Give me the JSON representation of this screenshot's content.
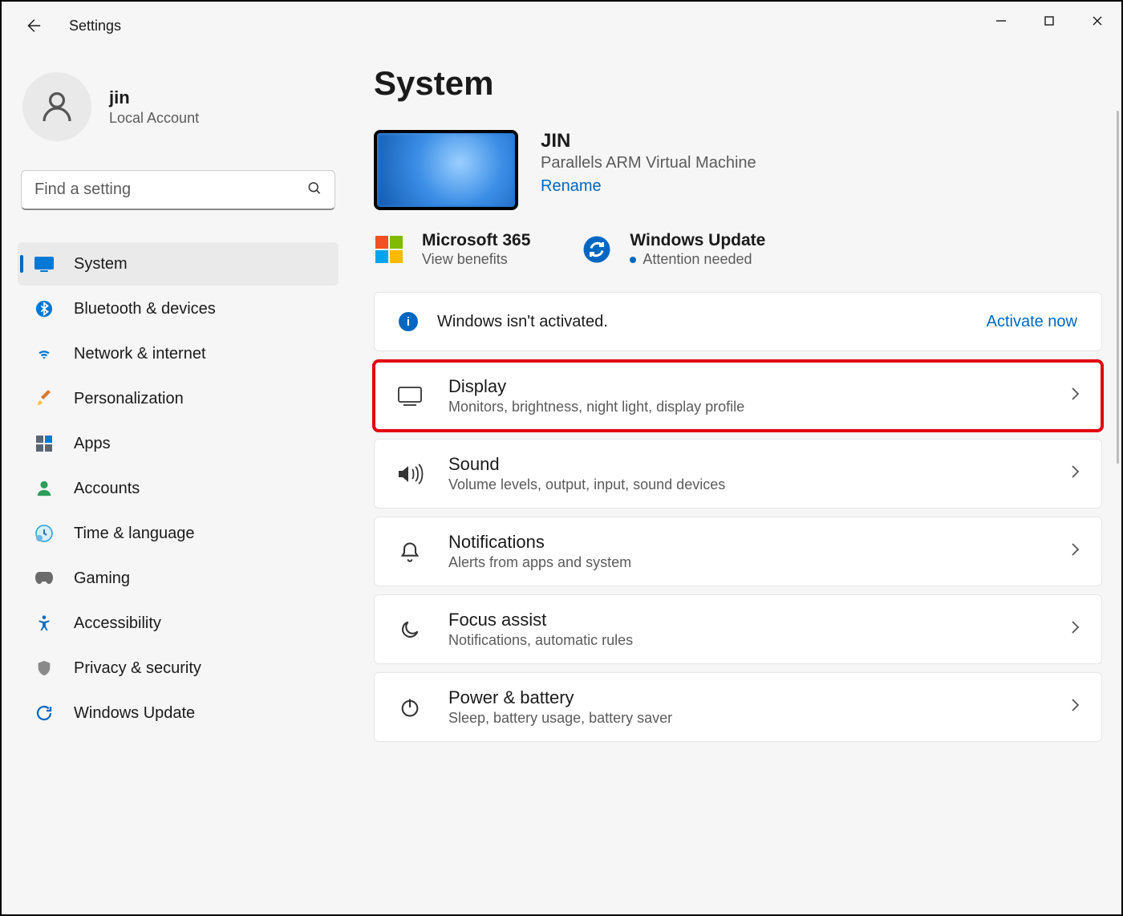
{
  "app_title": "Settings",
  "user": {
    "name": "jin",
    "subtitle": "Local Account"
  },
  "search": {
    "placeholder": "Find a setting"
  },
  "nav": [
    {
      "label": "System",
      "icon": "monitor",
      "selected": true
    },
    {
      "label": "Bluetooth & devices",
      "icon": "bluetooth"
    },
    {
      "label": "Network & internet",
      "icon": "wifi"
    },
    {
      "label": "Personalization",
      "icon": "brush"
    },
    {
      "label": "Apps",
      "icon": "apps"
    },
    {
      "label": "Accounts",
      "icon": "person"
    },
    {
      "label": "Time & language",
      "icon": "clock"
    },
    {
      "label": "Gaming",
      "icon": "gamepad"
    },
    {
      "label": "Accessibility",
      "icon": "accessibility"
    },
    {
      "label": "Privacy & security",
      "icon": "shield"
    },
    {
      "label": "Windows Update",
      "icon": "update"
    }
  ],
  "page": {
    "title": "System",
    "device": {
      "name": "JIN",
      "desc": "Parallels ARM Virtual Machine",
      "rename": "Rename"
    },
    "quick": {
      "m365": {
        "title": "Microsoft 365",
        "sub": "View benefits"
      },
      "wu": {
        "title": "Windows Update",
        "sub": "Attention needed"
      }
    },
    "activation": {
      "text": "Windows isn't activated.",
      "link": "Activate now"
    },
    "items": [
      {
        "title": "Display",
        "desc": "Monitors, brightness, night light, display profile",
        "icon": "display",
        "highlighted": true
      },
      {
        "title": "Sound",
        "desc": "Volume levels, output, input, sound devices",
        "icon": "sound"
      },
      {
        "title": "Notifications",
        "desc": "Alerts from apps and system",
        "icon": "bell"
      },
      {
        "title": "Focus assist",
        "desc": "Notifications, automatic rules",
        "icon": "moon"
      },
      {
        "title": "Power & battery",
        "desc": "Sleep, battery usage, battery saver",
        "icon": "power"
      }
    ]
  }
}
